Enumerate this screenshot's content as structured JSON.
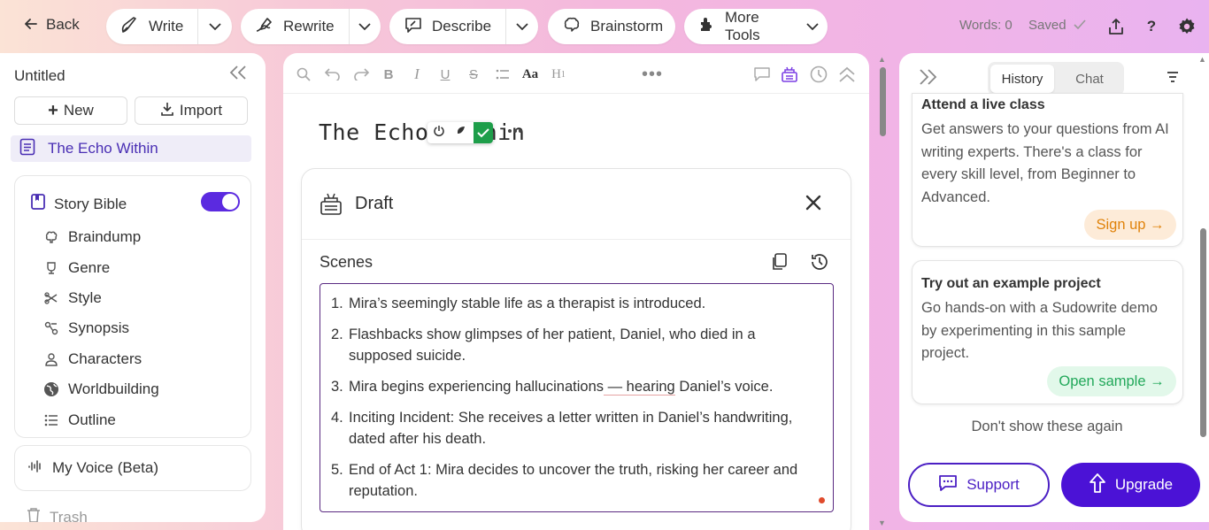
{
  "colors": {
    "accent": "#4b12d6",
    "accent_soft": "#efedf8",
    "signup_bg": "#fdebd8",
    "signup_text": "#e0820a",
    "sample_bg": "#e2f8ea",
    "sample_text": "#22a85a"
  },
  "topbar": {
    "back_label": "Back",
    "write_label": "Write",
    "rewrite_label": "Rewrite",
    "describe_label": "Describe",
    "brainstorm_label": "Brainstorm",
    "more_tools_label": "More Tools",
    "words": "Words: 0",
    "saved": "Saved"
  },
  "sidebar": {
    "title": "Untitled",
    "new_label": "New",
    "import_label": "Import",
    "document": "The Echo Within",
    "story_bible_label": "Story Bible",
    "story_bible_enabled": true,
    "items": [
      {
        "label": "Braindump",
        "icon": "brain-icon"
      },
      {
        "label": "Genre",
        "icon": "genre-icon"
      },
      {
        "label": "Style",
        "icon": "style-icon"
      },
      {
        "label": "Synopsis",
        "icon": "synopsis-icon"
      },
      {
        "label": "Characters",
        "icon": "characters-icon"
      },
      {
        "label": "Worldbuilding",
        "icon": "globe-icon"
      },
      {
        "label": "Outline",
        "icon": "list-icon"
      }
    ],
    "voice_label": "My Voice (Beta)",
    "trash_label": "Trash"
  },
  "editor": {
    "title": "The Echo Within",
    "draft_title": "Draft",
    "scenes_label": "Scenes",
    "scenes": [
      {
        "num": "1.",
        "text": "Mira’s seemingly stable life as a therapist is introduced."
      },
      {
        "num": "2.",
        "text": "Flashbacks show glimpses of her patient, Daniel, who died in a supposed suicide."
      },
      {
        "num": "3.",
        "text_before": "Mira begins experiencing hallucinations",
        "text_marked": " — hearing",
        "text_after": " Daniel’s voice."
      },
      {
        "num": "4.",
        "text": "Inciting Incident: She receives a letter written in Daniel’s handwriting, dated after his death."
      },
      {
        "num": "5.",
        "text": "End of Act 1: Mira decides to uncover the truth, risking her career and reputation."
      }
    ]
  },
  "rpanel": {
    "tabs": [
      {
        "label": "History",
        "active": true
      },
      {
        "label": "Chat",
        "active": false
      }
    ],
    "card1": {
      "title": "Attend a live class",
      "body": "Get answers to your questions from AI writing experts. There's a class for every skill level, from Beginner to Advanced.",
      "button": "Sign up →"
    },
    "card2": {
      "title": "Try out an example project",
      "body": "Go hands-on with a Sudowrite demo by experimenting in this sample project.",
      "button": "Open sample →"
    },
    "dont_show": "Don't show these again",
    "support_label": "Support",
    "upgrade_label": "Upgrade"
  }
}
